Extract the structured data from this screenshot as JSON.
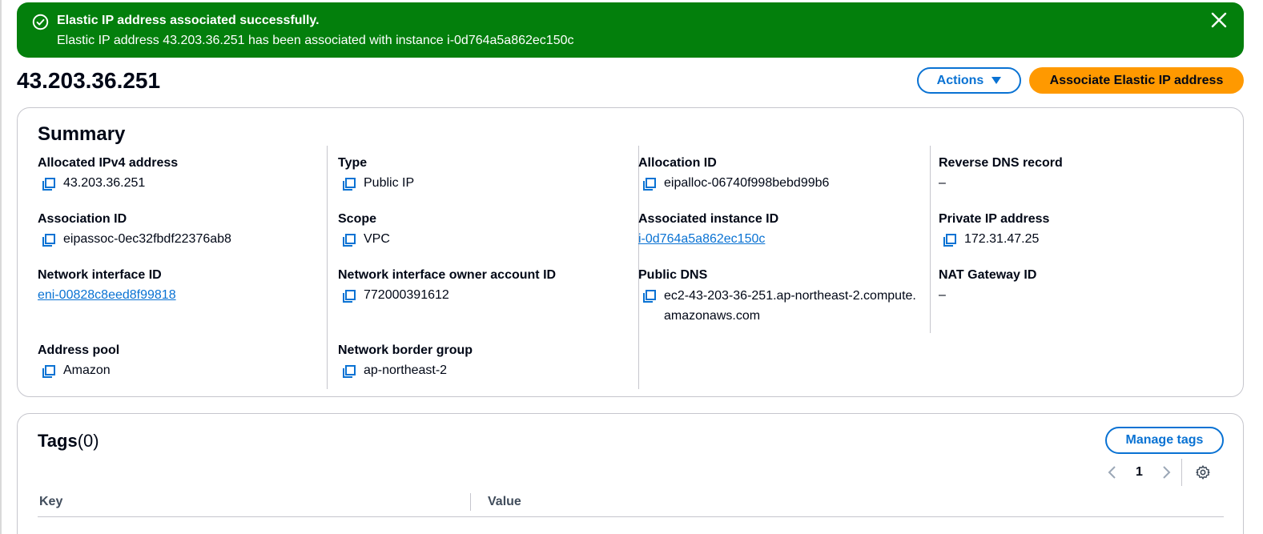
{
  "flash": {
    "title": "Elastic IP address associated successfully.",
    "message": "Elastic IP address 43.203.36.251 has been associated with instance i-0d764a5a862ec150c",
    "icon": "success-check-icon",
    "color": "#037f0c"
  },
  "header": {
    "title": "43.203.36.251",
    "actions_label": "Actions",
    "associate_label": "Associate Elastic IP address"
  },
  "summary": {
    "title": "Summary",
    "fields": {
      "allocated_ipv4": {
        "label": "Allocated IPv4 address",
        "value": "43.203.36.251"
      },
      "association_id": {
        "label": "Association ID",
        "value": "eipassoc-0ec32fbdf22376ab8"
      },
      "network_interface_id": {
        "label": "Network interface ID",
        "value": "eni-00828c8eed8f99818"
      },
      "address_pool": {
        "label": "Address pool",
        "value": "Amazon"
      },
      "type": {
        "label": "Type",
        "value": "Public IP"
      },
      "scope": {
        "label": "Scope",
        "value": "VPC"
      },
      "ni_owner": {
        "label": "Network interface owner account ID",
        "value": "772000391612"
      },
      "border_group": {
        "label": "Network border group",
        "value": "ap-northeast-2"
      },
      "allocation_id": {
        "label": "Allocation ID",
        "value": "eipalloc-06740f998bebd99b6"
      },
      "associated_instance": {
        "label": "Associated instance ID",
        "value": "i-0d764a5a862ec150c"
      },
      "public_dns": {
        "label": "Public DNS",
        "value": "ec2-43-203-36-251.ap-northeast-2.compute.amazonaws.com"
      },
      "reverse_dns": {
        "label": "Reverse DNS record",
        "value": "–"
      },
      "private_ip": {
        "label": "Private IP address",
        "value": "172.31.47.25"
      },
      "nat_gateway": {
        "label": "NAT Gateway ID",
        "value": "–"
      }
    }
  },
  "tags": {
    "title": "Tags",
    "count": "(0)",
    "manage_label": "Manage tags",
    "page": "1",
    "columns": [
      "Key",
      "Value"
    ]
  },
  "colors": {
    "primary": "#0972d3",
    "accent": "#ff9900",
    "success": "#037f0c"
  }
}
